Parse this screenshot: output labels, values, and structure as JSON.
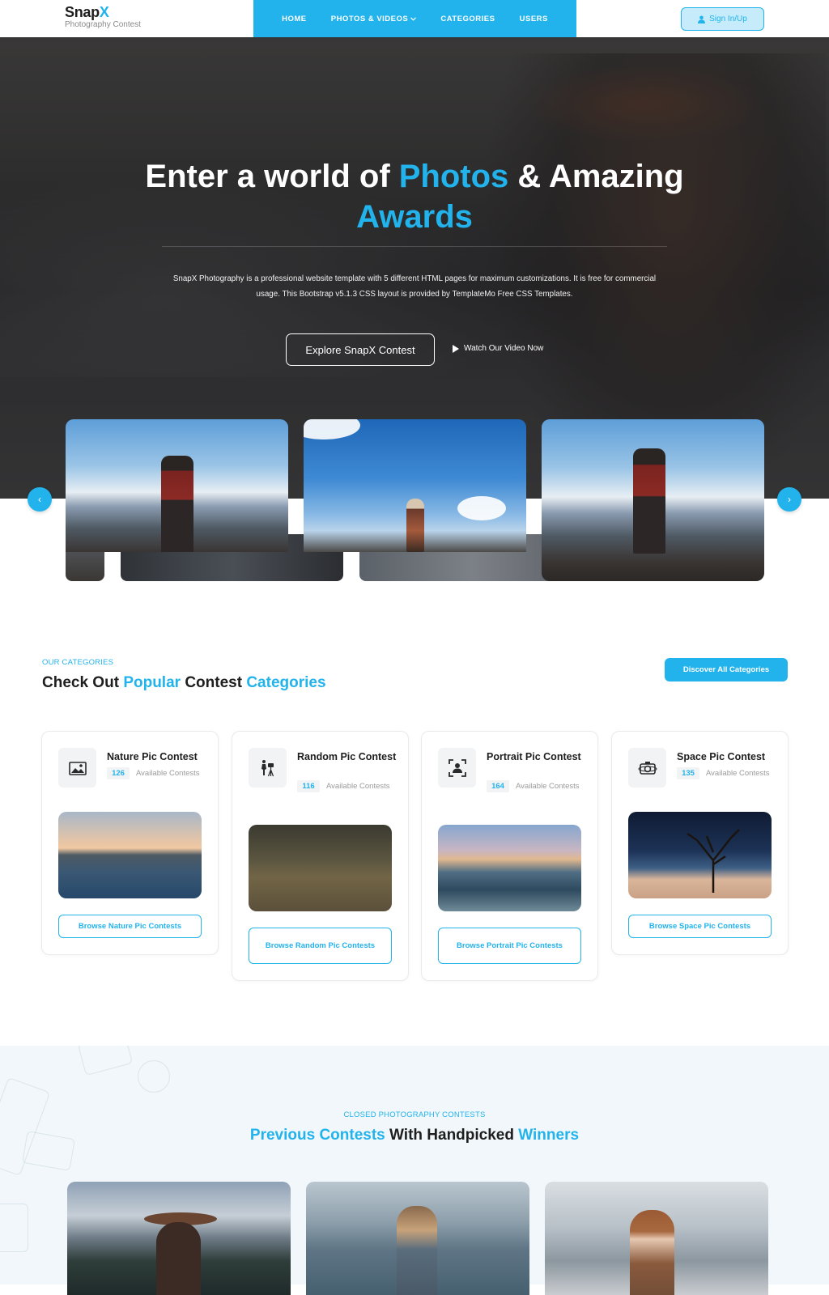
{
  "header": {
    "logo_main": "Snap",
    "logo_accent": "X",
    "logo_sub": "Photography Contest",
    "nav": [
      {
        "label": "HOME"
      },
      {
        "label": "PHOTOS & VIDEOS"
      },
      {
        "label": "CATEGORIES"
      },
      {
        "label": "USERS"
      }
    ],
    "signin_label": "Sign In/Up"
  },
  "hero": {
    "title_part1": "Enter a world of ",
    "title_highlight1": "Photos",
    "title_part2": " & Amazing",
    "title_highlight2": "Awards",
    "description": "SnapX Photography is a professional website template with 5 different HTML pages for maximum customizations. It is free for commercial usage. This Bootstrap v5.1.3 CSS layout is provided by TemplateMo Free CSS Templates.",
    "explore_label": "Explore SnapX Contest",
    "video_label": "Watch Our Video Now",
    "prev_glyph": "‹",
    "next_glyph": "›"
  },
  "categories": {
    "eyebrow": "OUR CATEGORIES",
    "title_a": "Check Out ",
    "title_b": "Popular",
    "title_c": " Contest ",
    "title_d": "Categories",
    "discover_label": "Discover All Categories",
    "available_label": "Available Contests",
    "items": [
      {
        "name": "Nature Pic Contest",
        "count": "126",
        "button": "Browse Nature Pic Contests",
        "icon": "landscape-picture-icon"
      },
      {
        "name": "Random Pic Contest",
        "count": "116",
        "button": "Browse Random Pic Contests",
        "icon": "photographer-tripod-icon"
      },
      {
        "name": "Portrait Pic Contest",
        "count": "164",
        "button": "Browse Portrait Pic Contests",
        "icon": "portrait-frame-icon"
      },
      {
        "name": "Space Pic Contest",
        "count": "135",
        "button": "Browse Space Pic Contests",
        "icon": "camera-space-icon"
      }
    ]
  },
  "previous": {
    "eyebrow": "CLOSED PHOTOGRAPHY CONTESTS",
    "title_a": "Previous Contests",
    "title_b": " With Handpicked ",
    "title_c": "Winners"
  },
  "colors": {
    "accent": "#22b3ec",
    "dark": "#1e1e1e"
  }
}
